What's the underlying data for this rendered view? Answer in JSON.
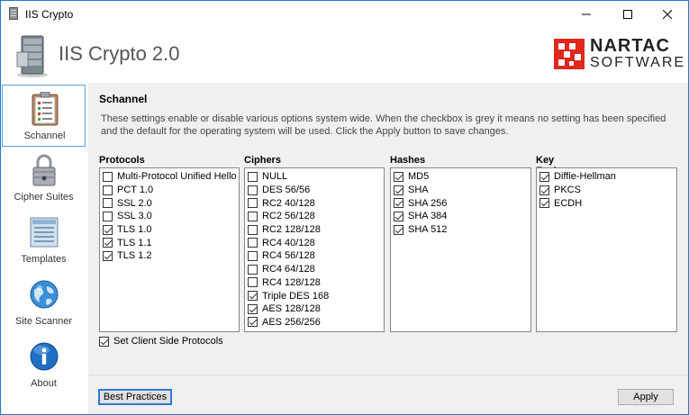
{
  "window": {
    "title": "IIS Crypto"
  },
  "header": {
    "app_title": "IIS Crypto 2.0",
    "logo_name": "NARTAC",
    "logo_sub": "SOFTWARE"
  },
  "sidebar": {
    "items": [
      {
        "label": "Schannel",
        "icon": "clipboard-icon",
        "active": true
      },
      {
        "label": "Cipher Suites",
        "icon": "lock-icon",
        "active": false
      },
      {
        "label": "Templates",
        "icon": "template-icon",
        "active": false
      },
      {
        "label": "Site Scanner",
        "icon": "globe-icon",
        "active": false
      },
      {
        "label": "About",
        "icon": "info-icon",
        "active": false
      }
    ]
  },
  "main": {
    "title": "Schannel",
    "description": "These settings enable or disable various options system wide. When the checkbox is grey it means no setting has been specified and the default for the operating system will be used. Click the Apply button to save changes.",
    "groups": [
      {
        "title": "Protocols",
        "items": [
          {
            "label": "Multi-Protocol Unified Hello",
            "checked": false
          },
          {
            "label": "PCT 1.0",
            "checked": false
          },
          {
            "label": "SSL 2.0",
            "checked": false
          },
          {
            "label": "SSL 3.0",
            "checked": false
          },
          {
            "label": "TLS 1.0",
            "checked": true
          },
          {
            "label": "TLS 1.1",
            "checked": true
          },
          {
            "label": "TLS 1.2",
            "checked": true
          }
        ]
      },
      {
        "title": "Ciphers",
        "items": [
          {
            "label": "NULL",
            "checked": false
          },
          {
            "label": "DES 56/56",
            "checked": false
          },
          {
            "label": "RC2 40/128",
            "checked": false
          },
          {
            "label": "RC2 56/128",
            "checked": false
          },
          {
            "label": "RC2 128/128",
            "checked": false
          },
          {
            "label": "RC4 40/128",
            "checked": false
          },
          {
            "label": "RC4 56/128",
            "checked": false
          },
          {
            "label": "RC4 64/128",
            "checked": false
          },
          {
            "label": "RC4 128/128",
            "checked": false
          },
          {
            "label": "Triple DES 168",
            "checked": true
          },
          {
            "label": "AES 128/128",
            "checked": true
          },
          {
            "label": "AES 256/256",
            "checked": true
          }
        ]
      },
      {
        "title": "Hashes",
        "items": [
          {
            "label": "MD5",
            "checked": true
          },
          {
            "label": "SHA",
            "checked": true
          },
          {
            "label": "SHA 256",
            "checked": true
          },
          {
            "label": "SHA 384",
            "checked": true
          },
          {
            "label": "SHA 512",
            "checked": true
          }
        ]
      },
      {
        "title": "Key Exchanges",
        "items": [
          {
            "label": "Diffie-Hellman",
            "checked": true
          },
          {
            "label": "PKCS",
            "checked": true
          },
          {
            "label": "ECDH",
            "checked": true
          }
        ]
      }
    ],
    "client_side": {
      "label": "Set Client Side Protocols",
      "checked": true
    }
  },
  "footer": {
    "best_practices": "Best Practices",
    "apply": "Apply"
  },
  "colors": {
    "accent": "#2c7ad6",
    "logo_red": "#e0281c",
    "panel_bg": "#f0f0f0"
  }
}
